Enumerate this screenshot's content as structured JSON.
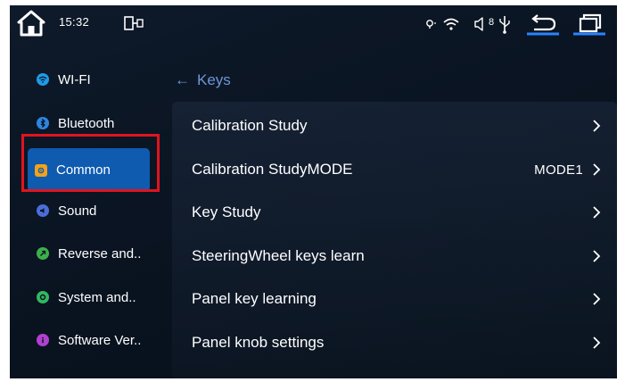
{
  "status_bar": {
    "time": "15:32",
    "volume_level": "8",
    "icons": [
      "home-icon",
      "dock-icon",
      "location-icon",
      "wifi-icon",
      "volume-icon",
      "usb-icon",
      "back-icon",
      "recent-apps-icon"
    ]
  },
  "sidebar": {
    "items": [
      {
        "label": "WI-FI",
        "icon": "wifi-icon",
        "icon_color": "#1e9be8"
      },
      {
        "label": "Bluetooth",
        "icon": "bluetooth-icon",
        "icon_color": "#2d86e0"
      },
      {
        "label": "Common",
        "icon": "gear-icon",
        "icon_color": "#f2a21a",
        "active": true
      },
      {
        "label": "Sound",
        "icon": "speaker-icon",
        "icon_color": "#4a6ed8"
      },
      {
        "label": "Reverse and..",
        "icon": "reverse-icon",
        "icon_color": "#3caf4a"
      },
      {
        "label": "System and..",
        "icon": "system-icon",
        "icon_color": "#32b860"
      },
      {
        "label": "Software Ver..",
        "icon": "info-icon",
        "icon_color": "#b040d0"
      }
    ]
  },
  "main": {
    "breadcrumb": "Keys",
    "rows": [
      {
        "label": "Calibration Study",
        "value": ""
      },
      {
        "label": "Calibration StudyMODE",
        "value": "MODE1"
      },
      {
        "label": "Key Study",
        "value": ""
      },
      {
        "label": "SteeringWheel keys learn",
        "value": ""
      },
      {
        "label": "Panel key learning",
        "value": ""
      },
      {
        "label": "Panel knob settings",
        "value": ""
      }
    ]
  },
  "colors": {
    "accent_active": "#0e5bb0",
    "breadcrumb": "#6f97d6",
    "highlight_box": "#e0141e"
  }
}
